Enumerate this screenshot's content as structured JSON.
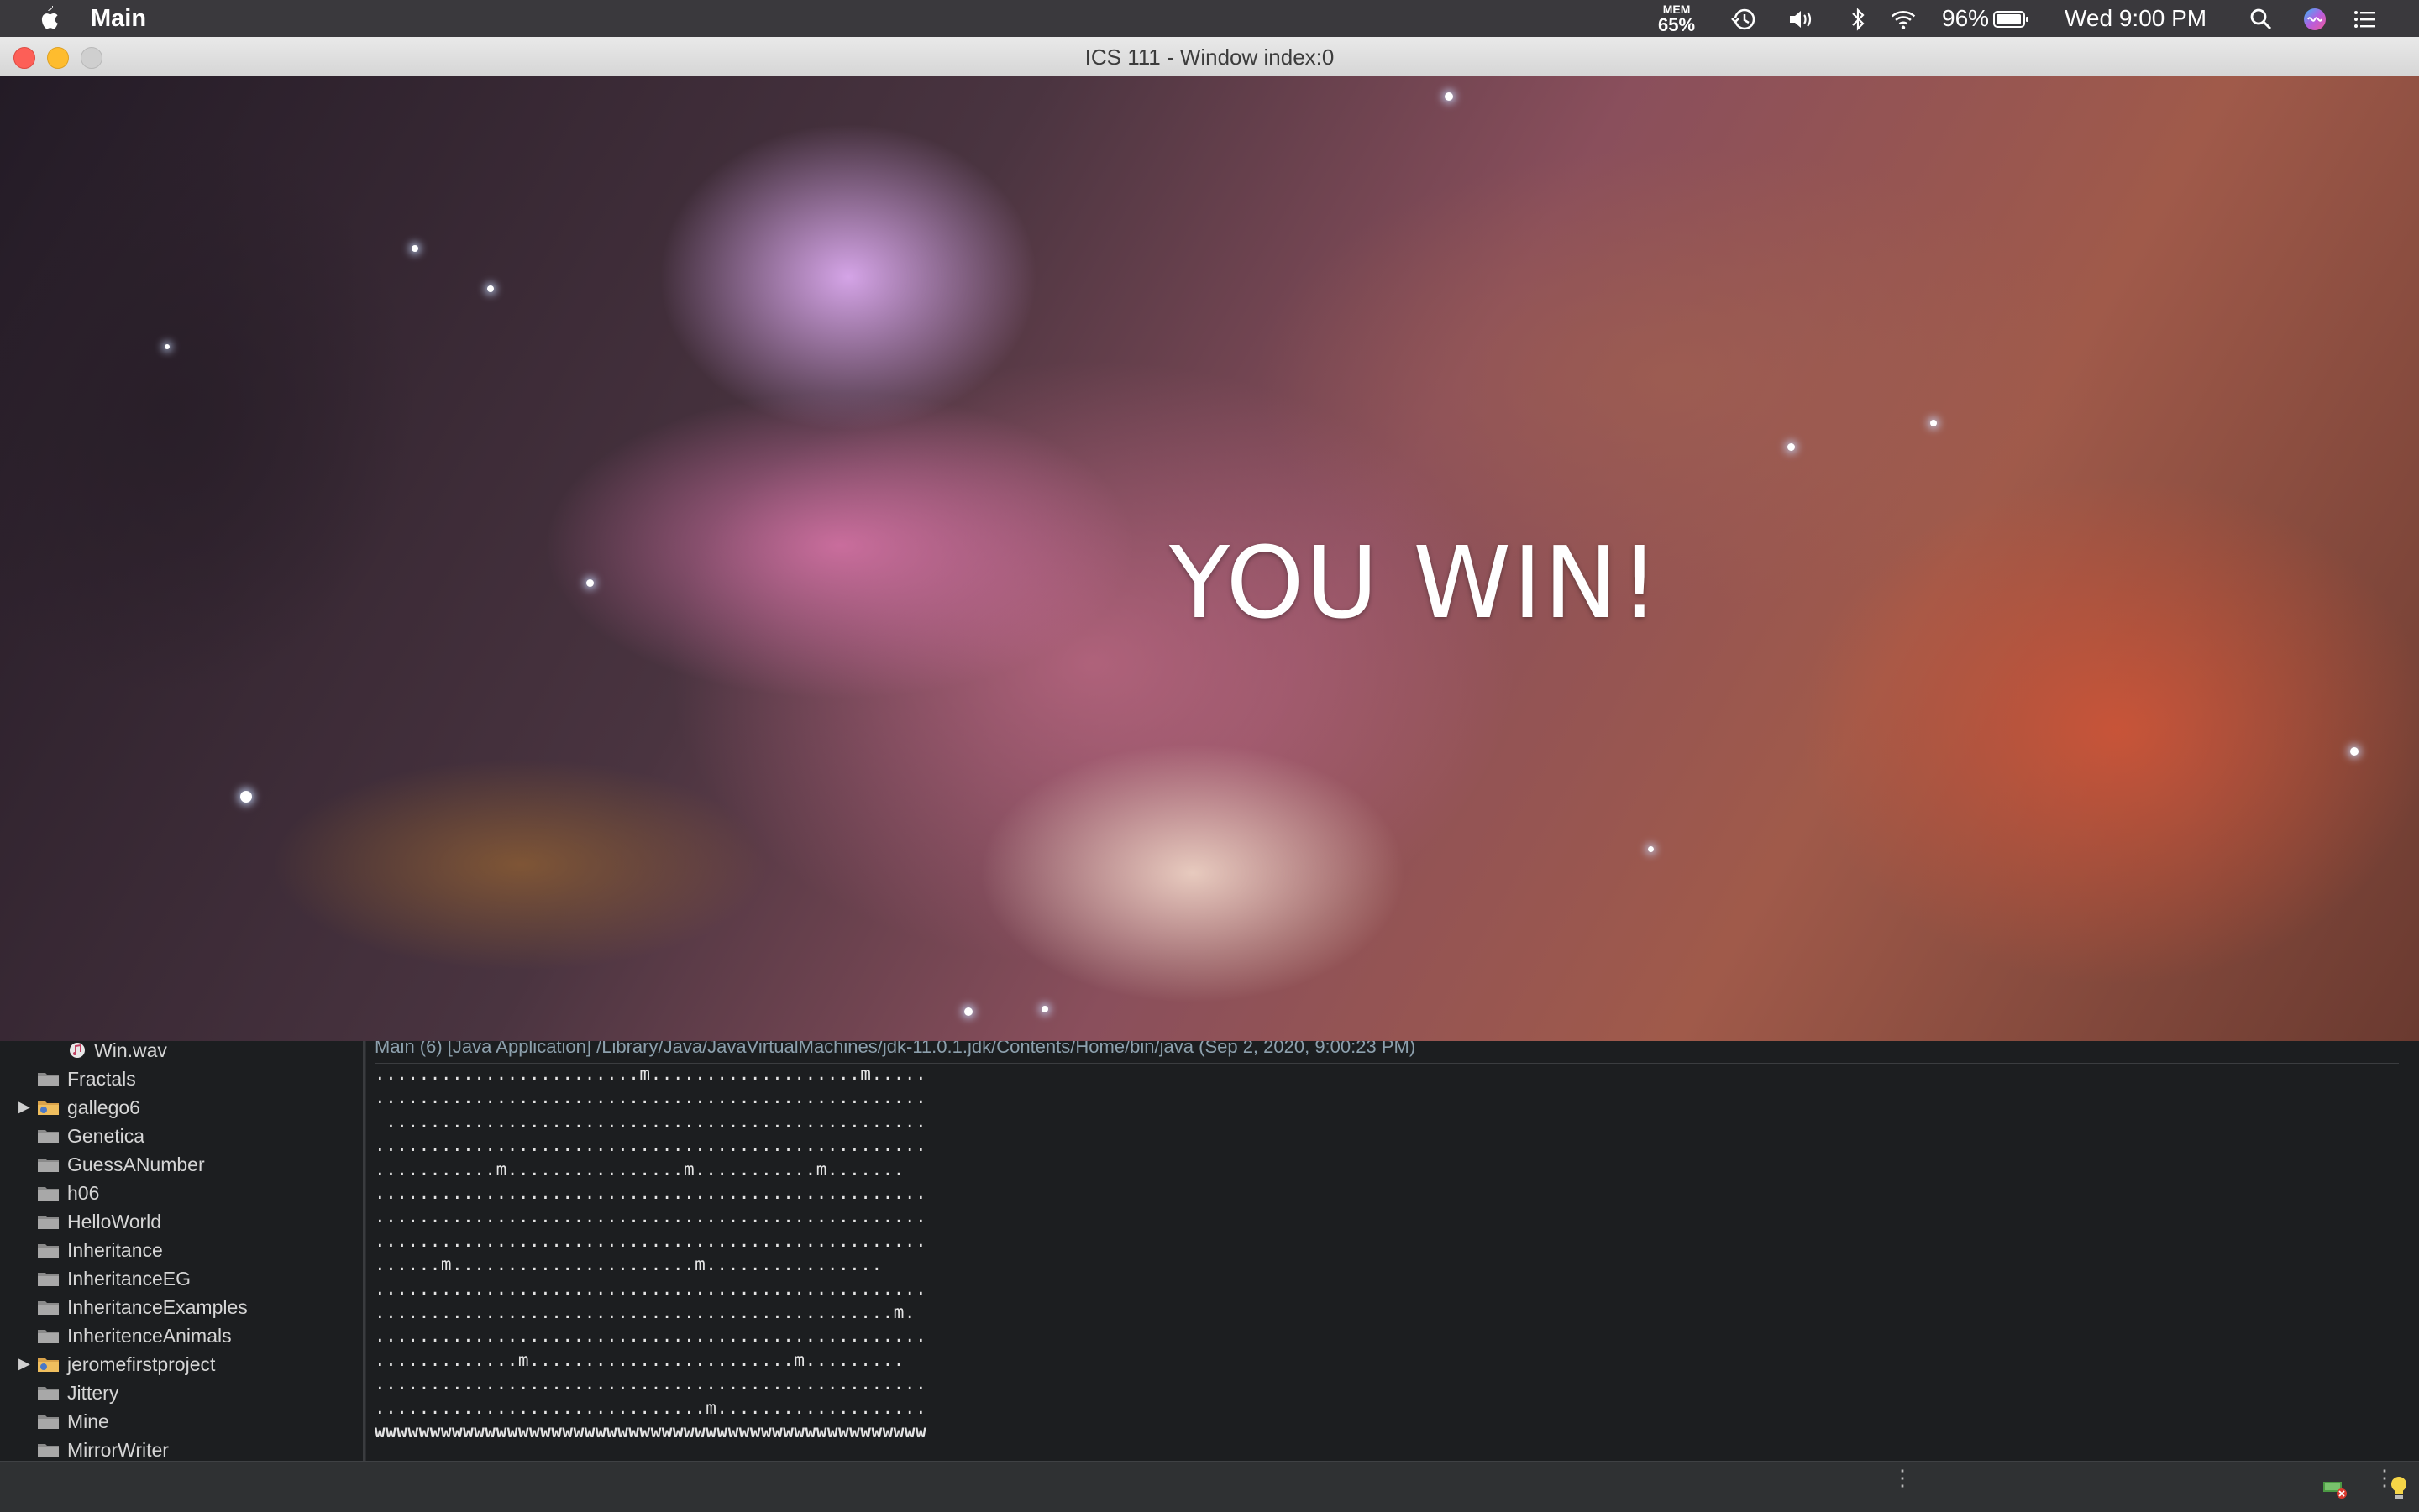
{
  "menubar": {
    "app_name": "Main",
    "mem_label": "MEM",
    "mem_value": "65%",
    "battery": "96%",
    "clock": "Wed 9:00 PM"
  },
  "window": {
    "title": "ICS 111 - Window index:0"
  },
  "game": {
    "message": "YOU WIN!"
  },
  "explorer": {
    "items": [
      {
        "label": "Win.wav",
        "type": "audio-file",
        "expandable": false
      },
      {
        "label": "Fractals",
        "type": "folder",
        "expandable": false
      },
      {
        "label": "gallego6",
        "type": "project",
        "expandable": true
      },
      {
        "label": "Genetica",
        "type": "folder",
        "expandable": false
      },
      {
        "label": "GuessANumber",
        "type": "folder",
        "expandable": false
      },
      {
        "label": "h06",
        "type": "folder",
        "expandable": false
      },
      {
        "label": "HelloWorld",
        "type": "folder",
        "expandable": false
      },
      {
        "label": "Inheritance",
        "type": "folder",
        "expandable": false
      },
      {
        "label": "InheritanceEG",
        "type": "folder",
        "expandable": false
      },
      {
        "label": "InheritanceExamples",
        "type": "folder",
        "expandable": false
      },
      {
        "label": "InheritenceAnimals",
        "type": "folder",
        "expandable": false
      },
      {
        "label": "jeromefirstproject",
        "type": "project",
        "expandable": true
      },
      {
        "label": "Jittery",
        "type": "folder",
        "expandable": false
      },
      {
        "label": "Mine",
        "type": "folder",
        "expandable": false
      },
      {
        "label": "MirrorWriter",
        "type": "folder",
        "expandable": false
      }
    ]
  },
  "console": {
    "header": "Main (6) [Java Application] /Library/Java/JavaVirtualMachines/jdk-11.0.1.jdk/Contents/Home/bin/java (Sep 2, 2020, 9:00:23 PM)",
    "lines": [
      "........................m...................m.....",
      "..................................................",
      " .................................................",
      "..................................................",
      "...........m................m...........m.......",
      "..................................................",
      "..................................................",
      "..................................................",
      "......m......................m................",
      "..................................................",
      "...............................................m.",
      "..................................................",
      ".............m........................m.........",
      "..................................................",
      "..............................m...................",
      "wwwwwwwwwwwwwwwwwwwwwwwwwwwwwwwwwwwwwwwwwwwwwwwwww"
    ]
  }
}
